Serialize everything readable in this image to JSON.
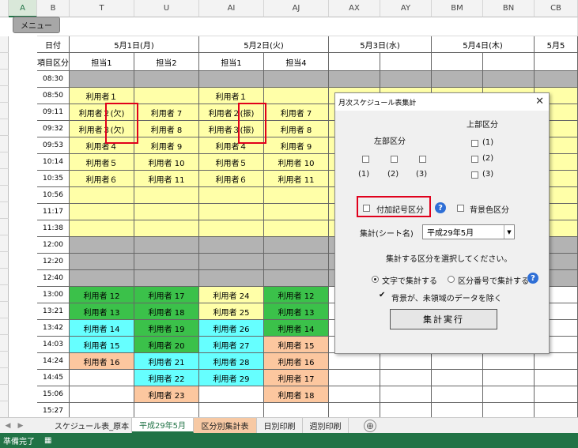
{
  "menu_button": "メニュー",
  "column_letters": [
    "A",
    "B",
    "T",
    "U",
    "AI",
    "AJ",
    "AX",
    "AY",
    "BM",
    "BN",
    "CB"
  ],
  "header": {
    "date_label": "日付",
    "item_label": "項目区分",
    "dates": [
      "5月1日(月)",
      "5月2日(火)",
      "5月3日(水)",
      "5月4日(木)",
      "5月5"
    ],
    "persons": [
      "担当1",
      "担当2",
      "担当1",
      "担当4"
    ]
  },
  "times": [
    "08:30",
    "08:50",
    "09:11",
    "09:32",
    "09:53",
    "10:14",
    "10:35",
    "10:56",
    "11:17",
    "11:38",
    "12:00",
    "12:20",
    "12:40",
    "13:00",
    "13:21",
    "13:42",
    "14:03",
    "14:24",
    "14:45",
    "15:06",
    "15:27"
  ],
  "schedule": {
    "T": [
      "",
      "利用者１",
      "利用者２(欠)",
      "利用者３(欠)",
      "利用者４",
      "利用者５",
      "利用者６",
      "",
      "",
      "",
      "",
      "",
      "",
      "利用者 12",
      "利用者 13",
      "利用者 14",
      "利用者 15",
      "利用者 16",
      "",
      "",
      ""
    ],
    "U": [
      "",
      "",
      "利用者 7",
      "利用者 8",
      "利用者 9",
      "利用者 10",
      "利用者 11",
      "",
      "",
      "",
      "",
      "",
      "",
      "利用者 17",
      "利用者 18",
      "利用者 19",
      "利用者 20",
      "利用者 21",
      "利用者 22",
      "利用者 23",
      ""
    ],
    "AI": [
      "",
      "利用者１",
      "利用者２(振)",
      "利用者３(振)",
      "利用者４",
      "利用者５",
      "利用者６",
      "",
      "",
      "",
      "",
      "",
      "",
      "利用者 24",
      "利用者 25",
      "利用者 26",
      "利用者 27",
      "利用者 28",
      "利用者 29",
      "",
      ""
    ],
    "AJ": [
      "",
      "",
      "利用者 7",
      "利用者 8",
      "利用者 9",
      "利用者 10",
      "利用者 11",
      "",
      "",
      "",
      "",
      "",
      "",
      "利用者 12",
      "利用者 13",
      "利用者 14",
      "利用者 15",
      "利用者 16",
      "利用者 17",
      "利用者 18",
      ""
    ]
  },
  "sheet_tabs": [
    "スケジュール表_原本",
    "平成29年5月",
    "区分別集計表",
    "日別印刷",
    "週別印刷"
  ],
  "add_sheet_icon": "⊕",
  "status_text": "準備完了",
  "dialog": {
    "title": "月次スケジュール表集計",
    "close": "✕",
    "left_section": "左部区分",
    "left_options": [
      "(1)",
      "(2)",
      "(3)"
    ],
    "top_section": "上部区分",
    "top_options": [
      "(1)",
      "(2)",
      "(3)"
    ],
    "suffix_checkbox": "付加記号区分",
    "bgcolor_checkbox": "背景色区分",
    "help_icon": "?",
    "sheet_label": "集計(シート名)",
    "sheet_value": "平成29年5月",
    "instruction": "集計する区分を選択してください。",
    "radio_text": "文字で集計する",
    "radio_number": "区分番号で集計する",
    "exclude_check": "✔",
    "exclude_label": "背景が、未領域のデータを除く",
    "run_button": "集計実行"
  },
  "colors": {
    "yellow": "#ffffa8",
    "gray": "#b3b3b3",
    "green": "#3bc14a",
    "cyan": "#66ffff",
    "orange": "#fcc79f",
    "excel_green": "#217346",
    "highlight_red": "#e0001c"
  }
}
